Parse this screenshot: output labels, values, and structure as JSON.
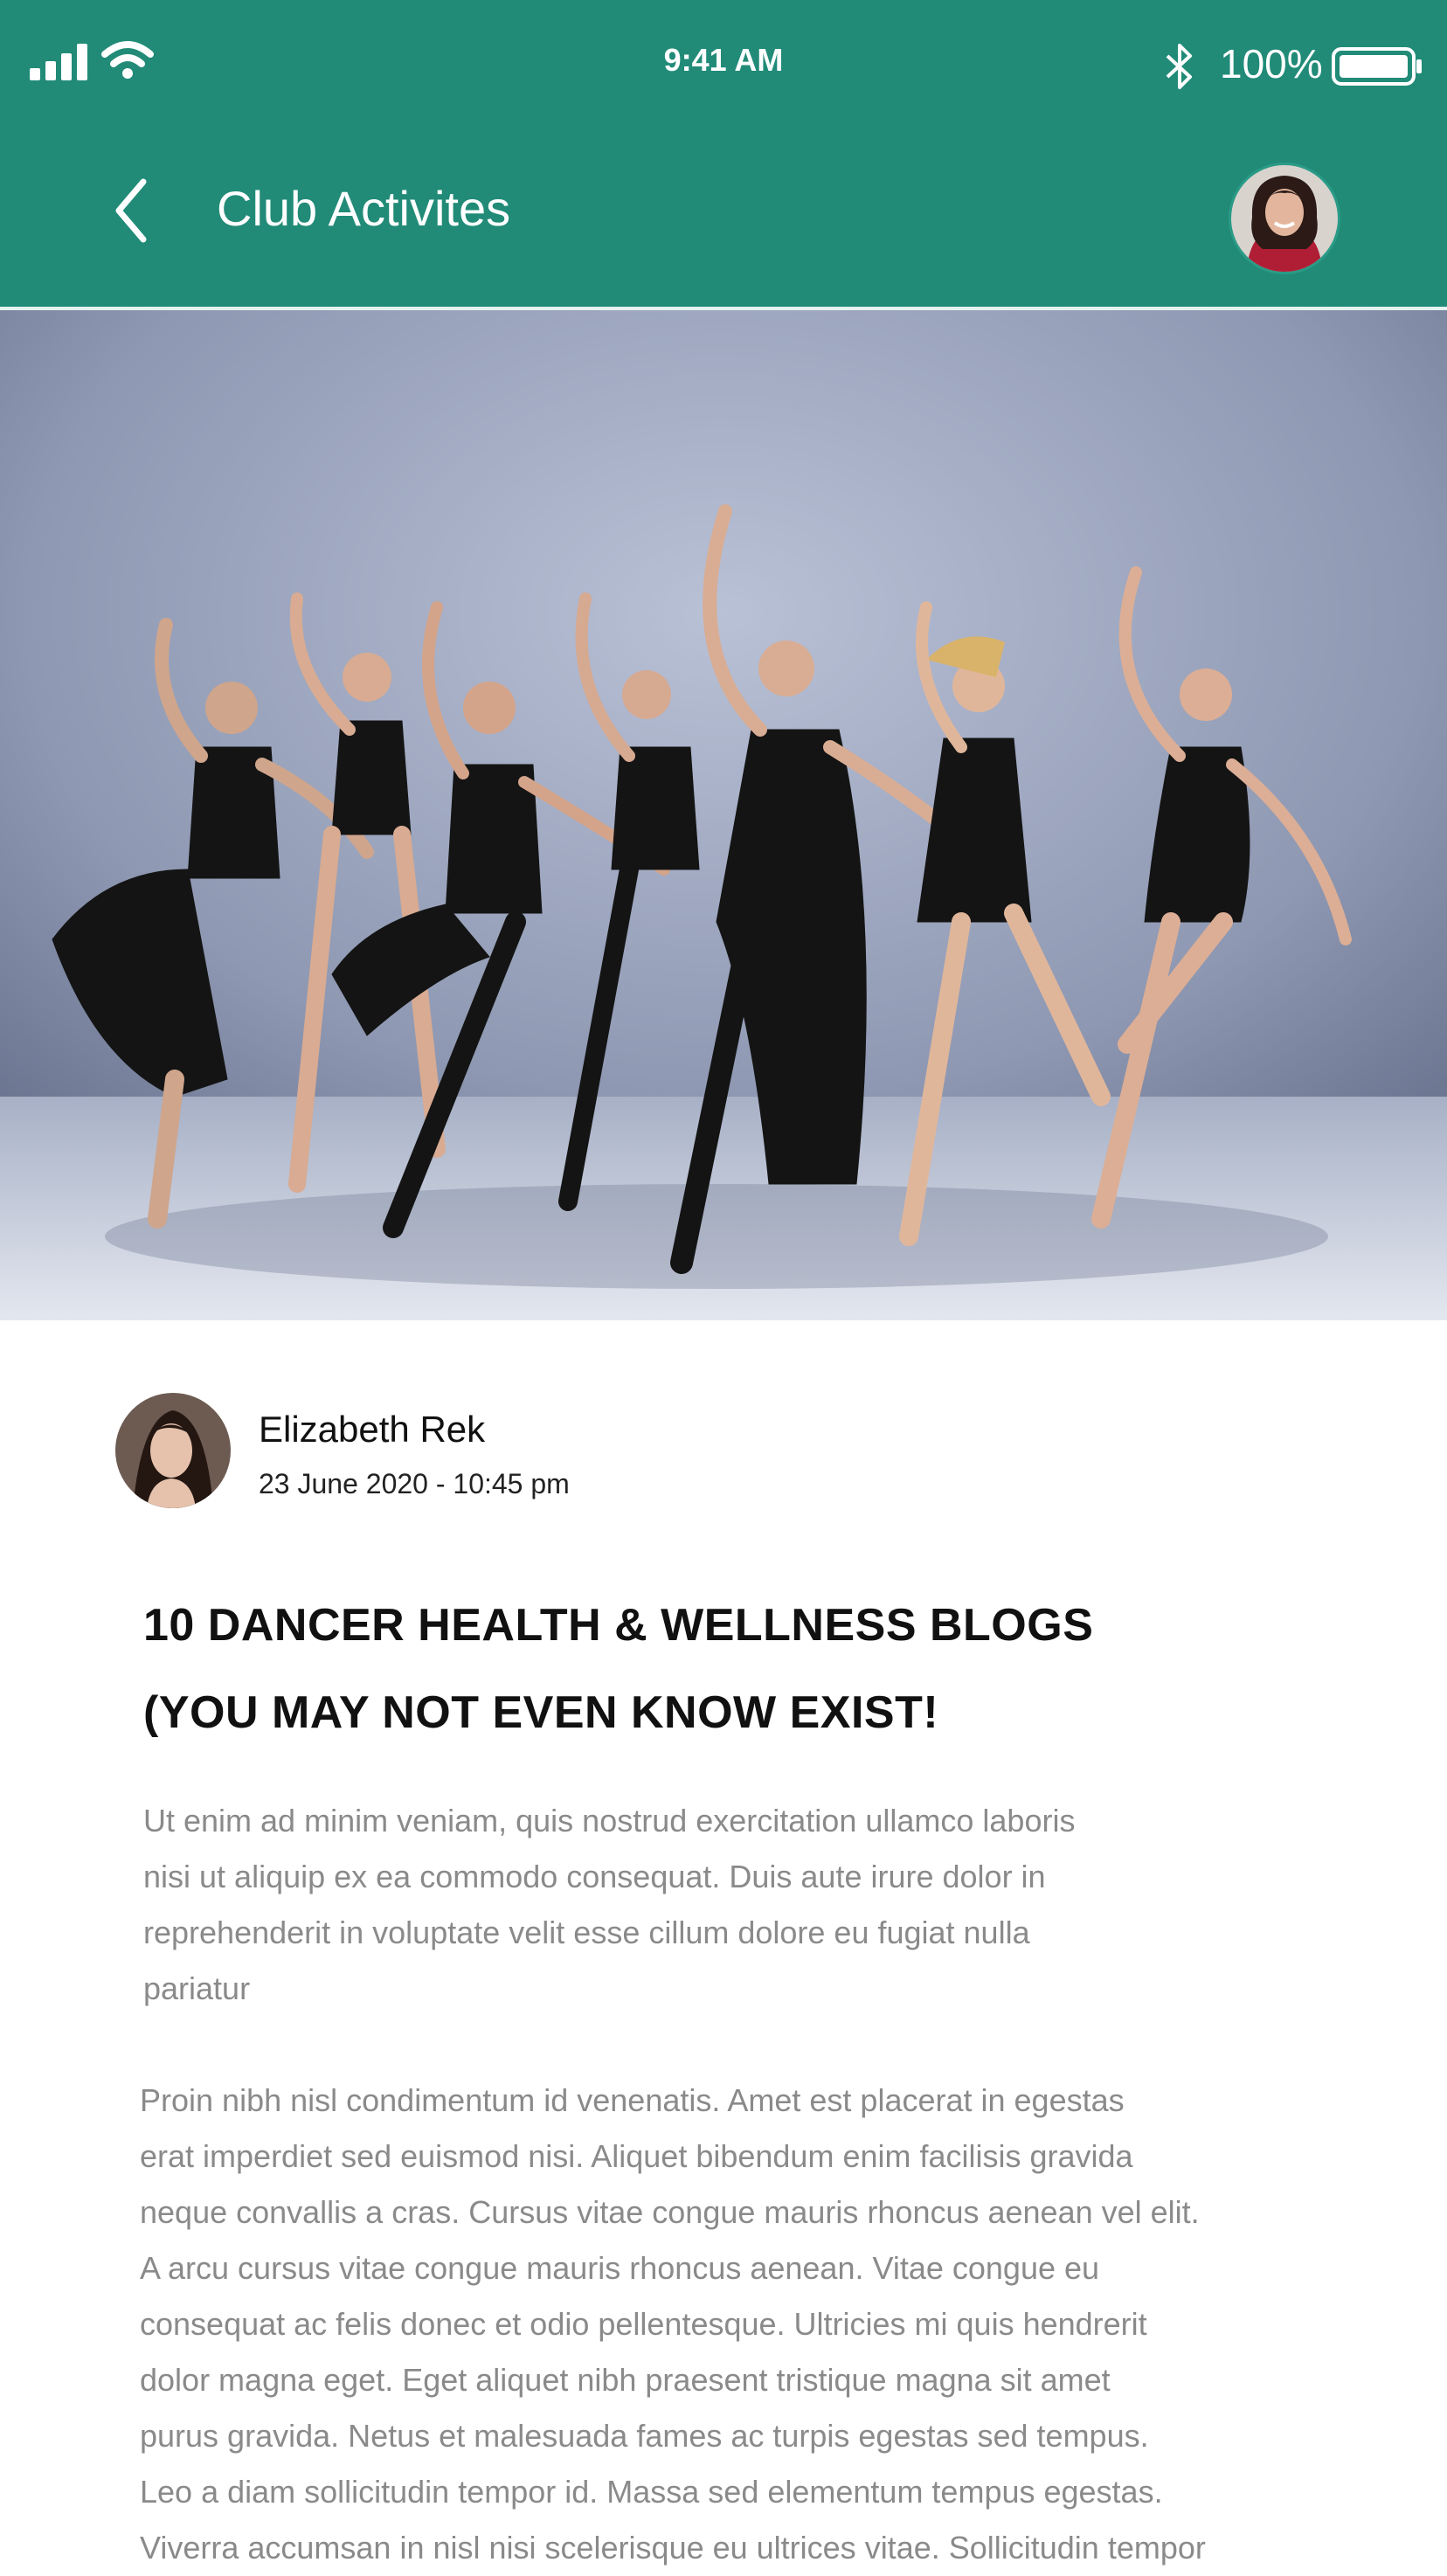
{
  "status_bar": {
    "time": "9:41 AM",
    "battery_percent": "100%",
    "icons": [
      "signal-icon",
      "wifi-icon",
      "bluetooth-icon",
      "battery-icon"
    ]
  },
  "header": {
    "title": "Club Activites",
    "back_icon": "chevron-left-icon",
    "background_color": "#218b78"
  },
  "article": {
    "author": {
      "name": "Elizabeth Rek",
      "date": "23 June 2020 - 10:45 pm"
    },
    "headline_lines": [
      "10 DANCER HEALTH & WELLNESS BLOGS",
      "(YOU MAY NOT EVEN KNOW EXIST!"
    ],
    "paragraph1_lines": [
      "Ut enim ad minim veniam, quis nostrud exercitation ullamco laboris",
      "nisi ut aliquip ex ea commodo consequat. Duis aute irure dolor in",
      "reprehenderit in voluptate velit esse cillum dolore eu fugiat nulla",
      "pariatur"
    ],
    "paragraph2_lines": [
      "Proin nibh nisl condimentum id venenatis. Amet est placerat in egestas",
      "erat imperdiet sed euismod nisi. Aliquet bibendum enim facilisis gravida",
      "neque convallis a cras. Cursus vitae congue mauris rhoncus aenean vel elit.",
      "A arcu cursus vitae congue mauris rhoncus aenean. Vitae congue eu",
      " consequat ac felis donec et odio pellentesque. Ultricies mi quis hendrerit",
      "dolor magna eget. Eget aliquet nibh praesent tristique magna sit amet",
      "purus gravida. Netus et malesuada fames ac turpis egestas sed tempus.",
      "Leo a diam sollicitudin tempor id. Massa sed elementum tempus egestas.",
      "Viverra accumsan in nisl nisi scelerisque eu ultrices vitae. Sollicitudin tempor"
    ]
  }
}
